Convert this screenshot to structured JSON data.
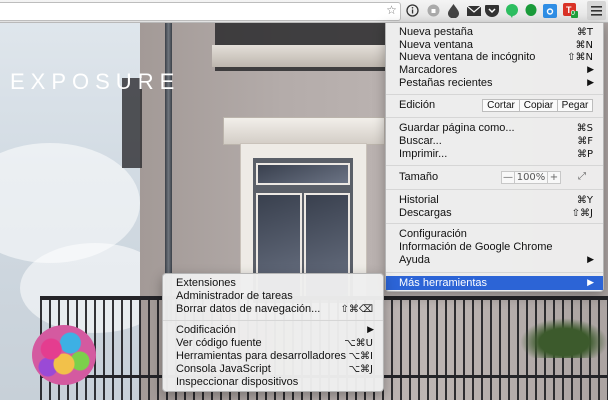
{
  "page": {
    "logo": "EXPOSURE"
  },
  "main_menu": {
    "items": [
      {
        "label": "Nueva pestaña",
        "shortcut": "⌘T"
      },
      {
        "label": "Nueva ventana",
        "shortcut": "⌘N"
      },
      {
        "label": "Nueva ventana de incógnito",
        "shortcut": "⇧⌘N"
      },
      {
        "label": "Marcadores",
        "shortcut": "▶"
      },
      {
        "label": "Pestañas recientes",
        "shortcut": "▶"
      }
    ],
    "edit": {
      "label": "Edición",
      "cut": "Cortar",
      "copy": "Copiar",
      "paste": "Pegar"
    },
    "page_items": [
      {
        "label": "Guardar página como...",
        "shortcut": "⌘S"
      },
      {
        "label": "Buscar...",
        "shortcut": "⌘F"
      },
      {
        "label": "Imprimir...",
        "shortcut": "⌘P"
      }
    ],
    "zoom": {
      "label": "Tamaño",
      "minus": "—",
      "value": "100%",
      "plus": "+",
      "fullscreen": "⤢"
    },
    "history_items": [
      {
        "label": "Historial",
        "shortcut": "⌘Y"
      },
      {
        "label": "Descargas",
        "shortcut": "⇧⌘J"
      }
    ],
    "settings_items": [
      {
        "label": "Configuración"
      },
      {
        "label": "Información de Google Chrome"
      },
      {
        "label": "Ayuda",
        "shortcut": "▶"
      }
    ],
    "more_tools": {
      "label": "Más herramientas",
      "shortcut": "▶"
    }
  },
  "sub_menu": {
    "items": [
      {
        "label": "Extensiones",
        "shortcut": ""
      },
      {
        "label": "Administrador de tareas",
        "shortcut": ""
      },
      {
        "label": "Borrar datos de navegación...",
        "shortcut": "⇧⌘⌫"
      }
    ],
    "dev_items": [
      {
        "label": "Codificación",
        "shortcut": "▶"
      },
      {
        "label": "Ver código fuente",
        "shortcut": "⌥⌘U"
      },
      {
        "label": "Herramientas para desarrolladores",
        "shortcut": "⌥⌘I"
      },
      {
        "label": "Consola JavaScript",
        "shortcut": "⌥⌘J"
      },
      {
        "label": "Inspeccionar dispositivos",
        "shortcut": ""
      }
    ]
  },
  "toolbar": {
    "icons": [
      "star-icon",
      "info-icon",
      "lastpass-icon",
      "drop-icon",
      "mail-icon",
      "pocket-icon",
      "evernote-icon",
      "camera-icon",
      "todoist-icon",
      "menu-icon"
    ],
    "badge": "0"
  }
}
